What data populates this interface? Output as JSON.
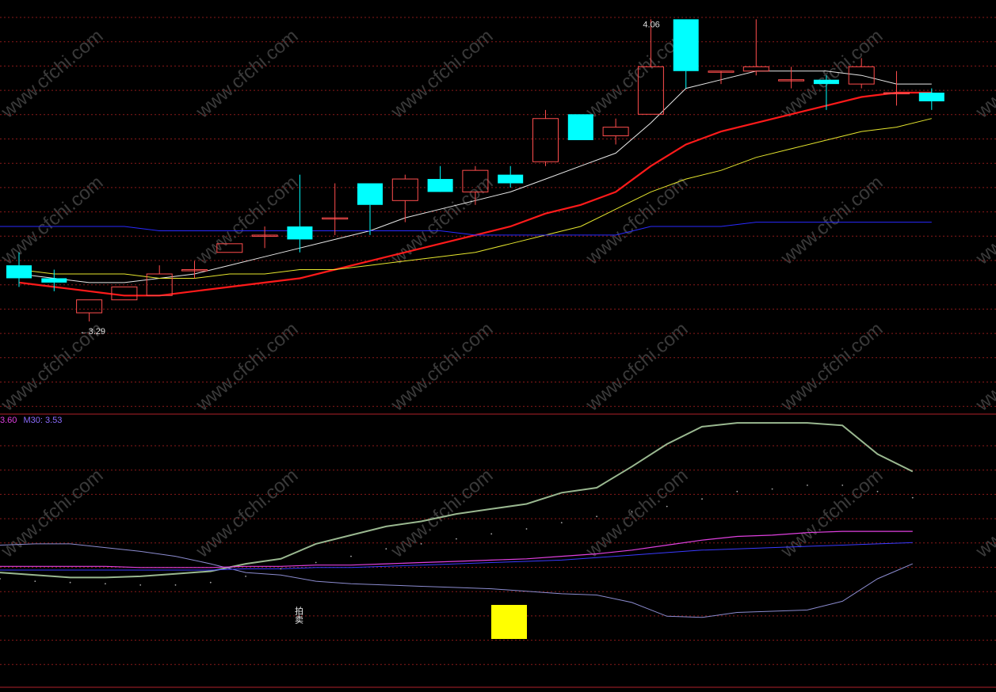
{
  "colors": {
    "background": "#000000",
    "grid": "#8a1a1a",
    "divider": "#b0202a",
    "up_candle": "#ff4d4d",
    "down_candle": "#00ffff",
    "ma5": "#e8e8e8",
    "ma10": "#ff1a1a",
    "ma20": "#e6e62e",
    "ma60": "#2a2aff",
    "osc_green": "#9ab890",
    "osc_lavender": "#8c8cd0",
    "osc_magenta": "#e040e0",
    "osc_blue": "#3a3aff",
    "marker": "#ffff00",
    "watermark": "#3a3a3a"
  },
  "watermark": "www.cfchi.com",
  "chart_data": [
    {
      "type": "candlestick",
      "panel": "main",
      "ylim": [
        3.16,
        4.09
      ],
      "annotations": [
        {
          "text": "4.06",
          "candle": 18,
          "at": "high"
        },
        {
          "text": "←3.29",
          "candle": 2,
          "at": "low"
        }
      ],
      "candles": [
        {
          "o": 3.49,
          "h": 3.52,
          "l": 3.44,
          "c": 3.46
        },
        {
          "o": 3.46,
          "h": 3.48,
          "l": 3.43,
          "c": 3.45
        },
        {
          "o": 3.38,
          "h": 3.41,
          "l": 3.36,
          "c": 3.41
        },
        {
          "o": 3.41,
          "h": 3.44,
          "l": 3.41,
          "c": 3.44
        },
        {
          "o": 3.42,
          "h": 3.49,
          "l": 3.42,
          "c": 3.47
        },
        {
          "o": 3.48,
          "h": 3.5,
          "l": 3.46,
          "c": 3.48
        },
        {
          "o": 3.52,
          "h": 3.54,
          "l": 3.52,
          "c": 3.54
        },
        {
          "o": 3.56,
          "h": 3.58,
          "l": 3.53,
          "c": 3.56
        },
        {
          "o": 3.58,
          "h": 3.7,
          "l": 3.52,
          "c": 3.55
        },
        {
          "o": 3.6,
          "h": 3.68,
          "l": 3.56,
          "c": 3.6
        },
        {
          "o": 3.68,
          "h": 3.68,
          "l": 3.56,
          "c": 3.63
        },
        {
          "o": 3.64,
          "h": 3.7,
          "l": 3.59,
          "c": 3.69
        },
        {
          "o": 3.69,
          "h": 3.72,
          "l": 3.68,
          "c": 3.66
        },
        {
          "o": 3.66,
          "h": 3.72,
          "l": 3.63,
          "c": 3.71
        },
        {
          "o": 3.7,
          "h": 3.72,
          "l": 3.67,
          "c": 3.68
        },
        {
          "o": 3.73,
          "h": 3.85,
          "l": 3.72,
          "c": 3.83
        },
        {
          "o": 3.84,
          "h": 3.84,
          "l": 3.79,
          "c": 3.78
        },
        {
          "o": 3.79,
          "h": 3.83,
          "l": 3.77,
          "c": 3.81
        },
        {
          "o": 3.84,
          "h": 4.06,
          "l": 3.84,
          "c": 3.95
        },
        {
          "o": 4.06,
          "h": 4.06,
          "l": 3.9,
          "c": 3.94
        },
        {
          "o": 3.94,
          "h": 3.94,
          "l": 3.91,
          "c": 3.94
        },
        {
          "o": 3.94,
          "h": 4.06,
          "l": 3.93,
          "c": 3.95
        },
        {
          "o": 3.92,
          "h": 3.95,
          "l": 3.9,
          "c": 3.92
        },
        {
          "o": 3.92,
          "h": 3.93,
          "l": 3.85,
          "c": 3.91
        },
        {
          "o": 3.91,
          "h": 3.97,
          "l": 3.9,
          "c": 3.95
        },
        {
          "o": 3.89,
          "h": 3.94,
          "l": 3.86,
          "c": 3.89
        },
        {
          "o": 3.89,
          "h": 3.9,
          "l": 3.85,
          "c": 3.87
        }
      ],
      "series": [
        {
          "key": "ma5",
          "values": [
            3.47,
            3.46,
            3.45,
            3.45,
            3.46,
            3.47,
            3.49,
            3.51,
            3.53,
            3.55,
            3.57,
            3.6,
            3.62,
            3.64,
            3.66,
            3.69,
            3.72,
            3.75,
            3.82,
            3.9,
            3.92,
            3.94,
            3.94,
            3.94,
            3.93,
            3.91,
            3.91
          ]
        },
        {
          "key": "ma10",
          "values": [
            3.45,
            3.44,
            3.43,
            3.42,
            3.42,
            3.43,
            3.44,
            3.45,
            3.46,
            3.48,
            3.5,
            3.52,
            3.54,
            3.56,
            3.58,
            3.61,
            3.63,
            3.66,
            3.72,
            3.77,
            3.8,
            3.82,
            3.84,
            3.86,
            3.88,
            3.89,
            3.89
          ]
        },
        {
          "key": "ma20",
          "values": [
            3.48,
            3.47,
            3.47,
            3.47,
            3.46,
            3.46,
            3.47,
            3.47,
            3.48,
            3.48,
            3.49,
            3.5,
            3.51,
            3.52,
            3.54,
            3.56,
            3.58,
            3.62,
            3.66,
            3.69,
            3.71,
            3.74,
            3.76,
            3.78,
            3.8,
            3.81,
            3.83
          ]
        },
        {
          "key": "ma60",
          "values": [
            3.58,
            3.58,
            3.58,
            3.58,
            3.57,
            3.57,
            3.57,
            3.57,
            3.57,
            3.57,
            3.57,
            3.57,
            3.57,
            3.56,
            3.56,
            3.56,
            3.56,
            3.56,
            3.58,
            3.58,
            3.58,
            3.59,
            3.59,
            3.59,
            3.59,
            3.59,
            3.59
          ]
        }
      ]
    },
    {
      "type": "line",
      "panel": "indicator",
      "legend": [
        {
          "text": "3.60",
          "color": "#e040e0"
        },
        {
          "text": "M30: 3.53",
          "color": "#8c6cff"
        }
      ],
      "ylim": [
        0,
        100
      ],
      "marker_text": "拍卖",
      "series": [
        {
          "key": "osc_green",
          "values": [
            25,
            23,
            21,
            21,
            22,
            24,
            26,
            32,
            36,
            48,
            55,
            62,
            66,
            72,
            76,
            80,
            89,
            93,
            110,
            128,
            142,
            145,
            145,
            145,
            143,
            120,
            106
          ]
        },
        {
          "key": "osc_lavender",
          "values": [
            47,
            48,
            48,
            45,
            42,
            38,
            32,
            25,
            23,
            18,
            16,
            15,
            14,
            13,
            12,
            10,
            8,
            7,
            1,
            -10,
            -11,
            -7,
            -6,
            -5,
            2,
            20,
            32
          ]
        },
        {
          "key": "osc_magenta",
          "values": [
            30,
            30,
            30,
            30,
            29,
            29,
            29,
            30,
            30,
            31,
            31,
            32,
            33,
            34,
            35,
            36,
            38,
            40,
            43,
            47,
            51,
            54,
            55,
            57,
            58,
            58,
            58
          ]
        },
        {
          "key": "osc_blue",
          "values": [
            27,
            27,
            27,
            27,
            27,
            27,
            27,
            28,
            28,
            29,
            29,
            30,
            31,
            32,
            33,
            34,
            35,
            37,
            39,
            41,
            43,
            44,
            45,
            46,
            47,
            48,
            49
          ]
        }
      ],
      "dots": [
        20,
        18,
        17,
        16,
        15,
        15,
        17,
        22,
        28,
        33,
        38,
        44,
        48,
        52,
        56,
        60,
        65,
        70,
        74,
        78,
        84,
        90,
        92,
        95,
        95,
        90,
        85
      ]
    }
  ]
}
